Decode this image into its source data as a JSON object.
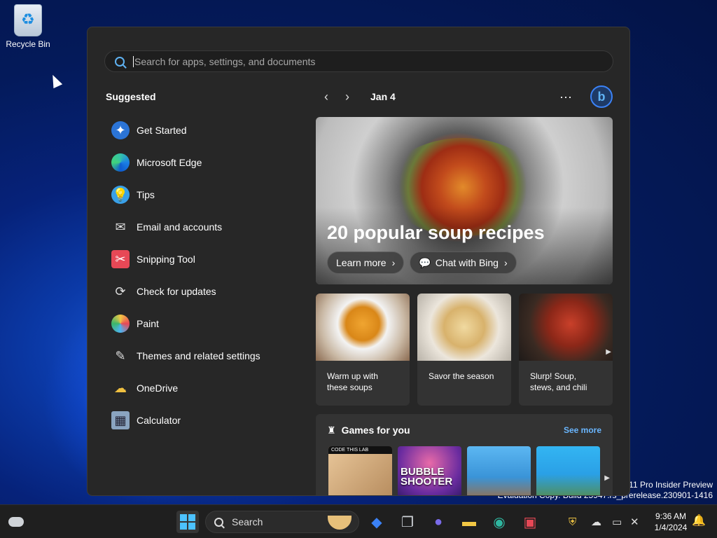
{
  "desktop": {
    "recycle_bin_label": "Recycle Bin",
    "watermark_line1": "s 11 Pro Insider Preview",
    "watermark_line2": "Evaluation Copy. Build 25947.rs_prerelease.230901-1416"
  },
  "start_menu": {
    "search_placeholder": "Search for apps, settings, and documents",
    "suggested_title": "Suggested",
    "apps": [
      {
        "label": "Get Started",
        "icon": "get-started-icon"
      },
      {
        "label": "Microsoft Edge",
        "icon": "edge-icon"
      },
      {
        "label": "Tips",
        "icon": "tips-icon"
      },
      {
        "label": "Email and accounts",
        "icon": "mail-icon"
      },
      {
        "label": "Snipping Tool",
        "icon": "snipping-tool-icon"
      },
      {
        "label": "Check for updates",
        "icon": "refresh-icon"
      },
      {
        "label": "Paint",
        "icon": "paint-icon"
      },
      {
        "label": "Themes and related settings",
        "icon": "brush-icon"
      },
      {
        "label": "OneDrive",
        "icon": "onedrive-icon"
      },
      {
        "label": "Calculator",
        "icon": "calculator-icon"
      }
    ],
    "feed": {
      "date": "Jan 4",
      "more": "···",
      "bing_letter": "b",
      "hero": {
        "title": "20 popular soup recipes",
        "learn_more": "Learn more",
        "chat_with_bing": "Chat with Bing"
      },
      "cards": [
        {
          "title": "Warm up with these soups"
        },
        {
          "title": "Savor the season"
        },
        {
          "title": "Slurp! Soup, stews, and chili"
        }
      ],
      "games": {
        "title": "Games for you",
        "see_more": "See more",
        "tile1_label": "CODE THIS LAB",
        "tile2_label": "BUBBLE SHOOTER"
      }
    }
  },
  "taskbar": {
    "search_label": "Search",
    "time": "9:36 AM",
    "date": "1/4/2024"
  },
  "colors": {
    "accent": "#4cc2ff",
    "start_bg": "#272727",
    "taskbar_bg": "#1f1f1f",
    "link": "#6ab6ff"
  }
}
